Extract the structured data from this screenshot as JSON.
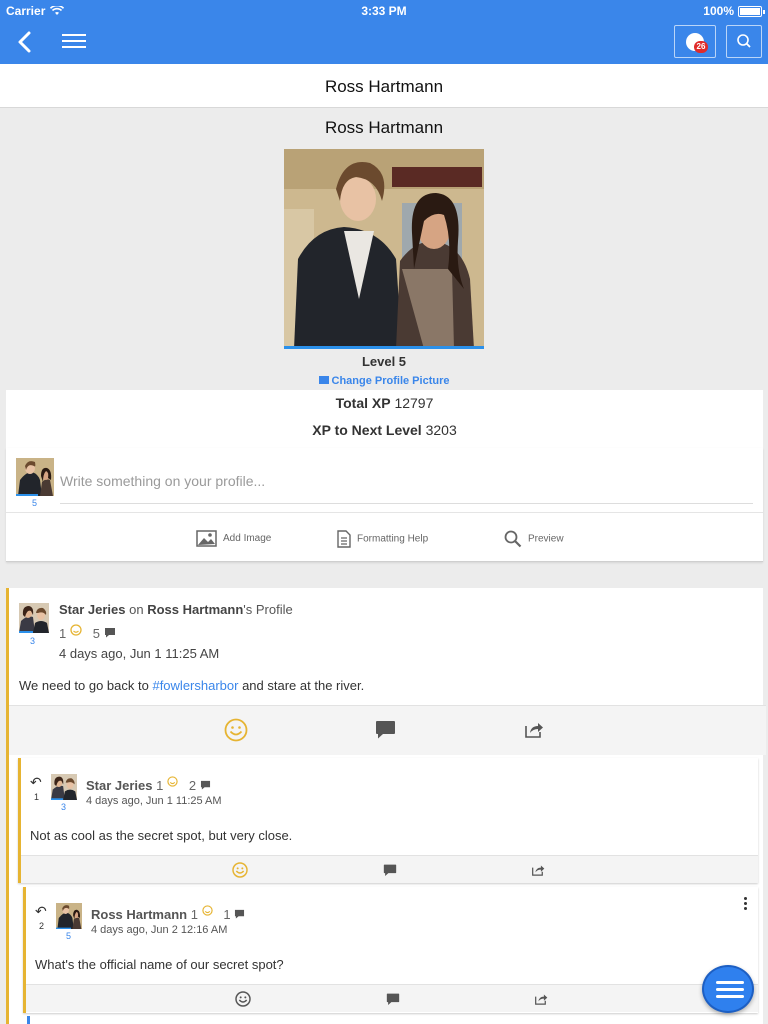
{
  "status_bar": {
    "carrier": "Carrier",
    "time": "3:33 PM",
    "battery": "100%"
  },
  "nav": {
    "notifications_count": "26"
  },
  "page_title": "Ross Hartmann",
  "profile": {
    "name": "Ross Hartmann",
    "level": "Level 5",
    "change_picture": "Change Profile Picture",
    "total_xp_label": "Total XP",
    "total_xp_value": "12797",
    "next_level_label": "XP to Next Level",
    "next_level_value": "3203"
  },
  "composer": {
    "avatar_level": "5",
    "placeholder": "Write something on your profile...",
    "add_image": "Add Image",
    "formatting_help": "Formatting Help",
    "preview": "Preview"
  },
  "post": {
    "author": "Star Jeries",
    "on_text": "on",
    "profile_owner": "Ross Hartmann",
    "profile_suffix": "'s Profile",
    "avatar_level": "3",
    "smiles": "1",
    "comments": "5",
    "date": "4 days ago, Jun 1 11:25 AM",
    "body_before": "We need to go back to ",
    "hashtag": "#fowlersharbor",
    "body_after": " and stare at the river."
  },
  "replies": [
    {
      "index": "1",
      "author": "Star Jeries",
      "avatar_level": "3",
      "smiles": "1",
      "comments": "2",
      "date": "4 days ago, Jun 1 11:25 AM",
      "body": "Not as cool as the secret spot, but very close."
    },
    {
      "index": "2",
      "author": "Ross Hartmann",
      "avatar_level": "5",
      "smiles": "1",
      "comments": "1",
      "date": "4 days ago, Jun 2 12:16 AM",
      "body": "What's the official name of our secret spot?"
    }
  ],
  "colors": {
    "brand": "#3a86ea",
    "accent_gold": "#e6b432",
    "notification_badge": "#e02b2b"
  }
}
